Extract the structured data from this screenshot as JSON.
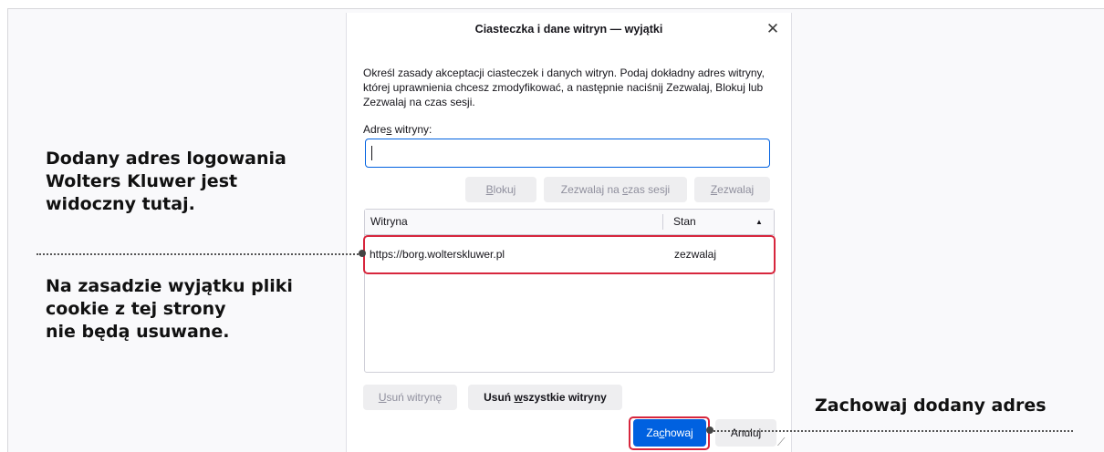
{
  "dialog": {
    "title": "Ciasteczka i dane witryn — wyjątki",
    "close_glyph": "✕",
    "description": "Określ zasady akceptacji ciasteczek i danych witryn. Podaj dokładny adres witryny, której uprawnienia chcesz zmodyfikować, a następnie naciśnij Zezwalaj, Blokuj lub Zezwalaj na czas sesji.",
    "address_label_pre": "Adre",
    "address_label_key": "s",
    "address_label_post": " witryny:",
    "address_value": "",
    "buttons": {
      "block": {
        "key": "B",
        "rest": "lokuj"
      },
      "session": {
        "pre": "Zezwalaj na ",
        "key": "c",
        "post": "zas sesji"
      },
      "allow": {
        "key": "Z",
        "rest": "ezwalaj"
      },
      "remove_site": {
        "key": "U",
        "rest": "suń witrynę"
      },
      "remove_all": {
        "pre": "Usuń ",
        "key": "w",
        "post": "szystkie witryny"
      },
      "save": {
        "pre": "Za",
        "key": "c",
        "post": "howaj"
      },
      "cancel": "Anuluj"
    },
    "table": {
      "columns": [
        "Witryna",
        "Stan"
      ],
      "sort_glyph": "▲",
      "rows": [
        {
          "site": "https://borg.wolterskluwer.pl",
          "status": "zezwalaj"
        }
      ]
    },
    "resize_glyph": "⟋"
  },
  "annotations": {
    "added_address": [
      "Dodany adres logowania",
      "Wolters Kluwer jest",
      "widoczny tutaj."
    ],
    "exception_note": [
      "Na zasadzie wyjątku pliki",
      "cookie z tej strony",
      "nie będą usuwane."
    ],
    "save_note": "Zachowaj dodany adres"
  },
  "colors": {
    "accent": "#0061e0",
    "highlight": "#d7263d"
  }
}
